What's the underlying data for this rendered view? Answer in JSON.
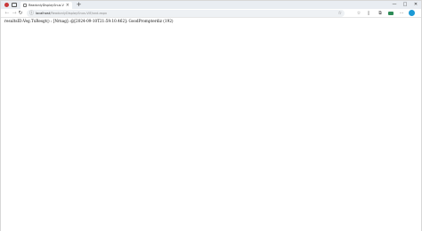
{
  "browser": {
    "tab": {
      "title": "ReadonlyDisplaySnus.ViE...",
      "close_glyph": "×"
    },
    "new_tab_glyph": "+",
    "window_controls": {
      "minimize": "—",
      "maximize": "□",
      "close": "✕"
    },
    "nav": {
      "back": "←",
      "forward": "→",
      "reload": "↻"
    },
    "address": {
      "info_glyph": "ⓘ",
      "host": "localhost",
      "path": "/ReadonlyDisplaySnus.ViE/snd.aspx",
      "star_glyph": "☆"
    },
    "toolbar_glyphs": {
      "favorites": "☆",
      "split": "▯",
      "collections": "⧉",
      "more": "···"
    },
    "icons": [
      "profile-icon",
      "tab-actions-icon",
      "page-favicon",
      "info-icon",
      "favorite-star-icon",
      "favorites-icon",
      "split-screen-icon",
      "collections-icon",
      "extension-icon",
      "more-icon",
      "copilot-icon"
    ]
  },
  "page": {
    "content_text": "resultsID:Veg.TxResgt() : [Nrnag]: @[2024-09-10T21:59:10.462]: GoodPrompterdiz (192)"
  },
  "colors": {
    "profile": "#c9383a",
    "extension": "#2e8b57",
    "copilot": "#1b9ad6"
  }
}
